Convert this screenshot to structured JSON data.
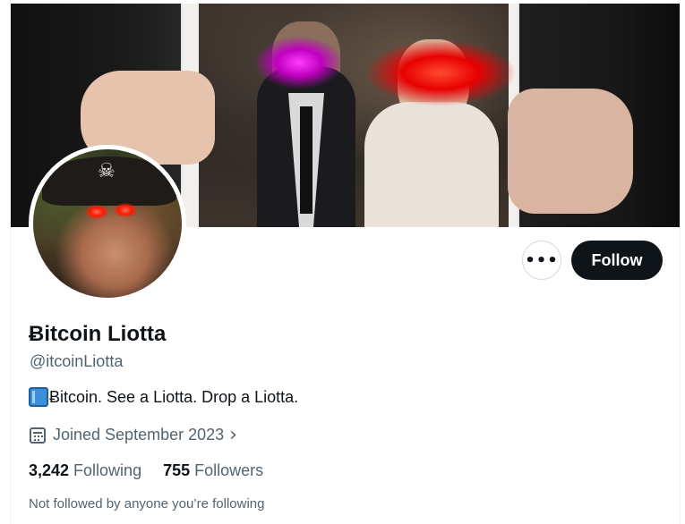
{
  "profile": {
    "display_name": "Ƀitcoin Liotta",
    "handle": "@itcoinLiotta",
    "bio_text": "Ƀitcoin. See a Liotta. Drop a Liotta.",
    "bio_icon": "blue-book-icon",
    "joined": "Joined September 2023",
    "stats": {
      "following_count": "3,242",
      "following_label": "Following",
      "followers_count": "755",
      "followers_label": "Followers"
    },
    "followers_note": "Not followed by anyone you’re following"
  },
  "actions": {
    "more_label": "•••",
    "follow_label": "Follow"
  },
  "icons": {
    "more": "more-options-icon",
    "calendar": "calendar-icon",
    "chevron": "chevron-right-icon"
  },
  "colors": {
    "text_primary": "#0f1419",
    "text_secondary": "#536471",
    "follow_bg": "#0f1419",
    "border": "#cfd9de"
  }
}
